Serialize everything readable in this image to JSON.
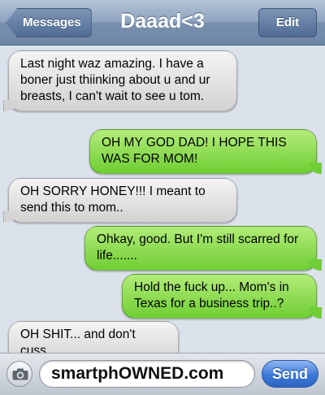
{
  "nav": {
    "back_label": "Messages",
    "title": "Daaad<3",
    "edit_label": "Edit"
  },
  "messages": [
    {
      "direction": "incoming",
      "text": "Last night waz amazing. I have a boner just thiinking about u and ur breasts, I can't wait to see u tom."
    },
    {
      "direction": "outgoing",
      "text": "OH MY GOD DAD! I HOPE THIS WAS FOR MOM!"
    },
    {
      "direction": "incoming",
      "text": "OH SORRY HONEY!!! I meant to send this to mom.."
    },
    {
      "direction": "outgoing",
      "text": "Ohkay, good. But I'm still scarred for life......."
    },
    {
      "direction": "outgoing",
      "text": "Hold the fuck up... Mom's in Texas for a business trip..?"
    },
    {
      "direction": "incoming",
      "text": "OH SHIT... and don't cuss."
    }
  ],
  "input_bar": {
    "camera_icon": "camera-icon",
    "field_text": "smartphOWNED.com",
    "send_label": "Send"
  },
  "colors": {
    "incoming_bubble": "#dcdcdc",
    "outgoing_bubble": "#8ddc52",
    "send_button": "#3c79d8",
    "nav_bar": "#8ea4bf"
  }
}
